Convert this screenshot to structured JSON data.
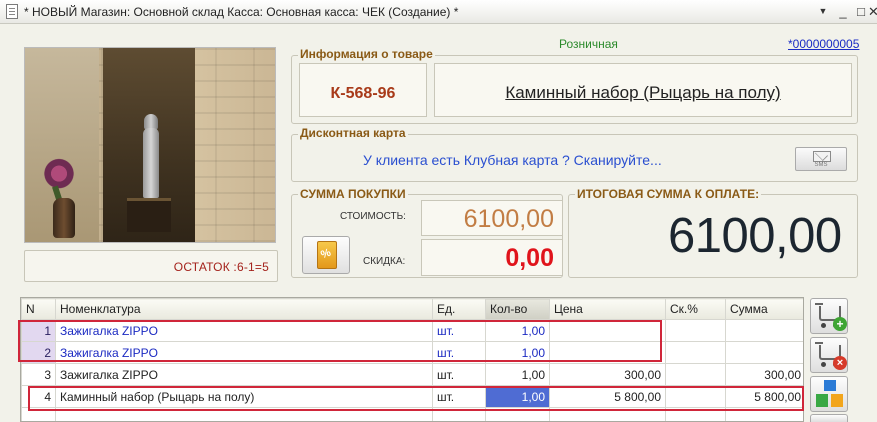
{
  "window": {
    "title": "* НОВЫЙ Магазин: Основной склад Касса: Основная касса: ЧЕК (Создание) *",
    "menu_glyph": "▼",
    "minimize_glyph": "_",
    "maximize_glyph": "□",
    "close_glyph": "✕"
  },
  "header": {
    "price_type": "Розничная",
    "doc_number": "*0000000005"
  },
  "stock": {
    "text": "ОСТАТОК :6-1=5"
  },
  "product_info": {
    "label": "Информация о товаре",
    "article": "К-568-96",
    "name": "Каминный набор (Рыцарь на полу)"
  },
  "discount_card": {
    "label": "Дисконтная карта",
    "prompt": "У клиента есть Клубная карта ? Сканируйте...",
    "sms_label": "SMS"
  },
  "purchase": {
    "label": "СУММА ПОКУПКИ",
    "cost_label": "СТОИМОСТЬ:",
    "cost_value": "6100,00",
    "discount_label": "СКИДКА:",
    "discount_value": "0,00",
    "coupon_glyph": "%"
  },
  "total": {
    "label": "ИТОГОВАЯ СУММА К ОПЛАТЕ:",
    "value": "6100,00"
  },
  "table": {
    "columns": [
      "N",
      "Номенклатура",
      "Ед.",
      "Кол-во",
      "Цена",
      "Ск.%",
      "Сумма"
    ],
    "rows": [
      {
        "n": "1",
        "item": "Зажигалка ZIPPO",
        "unit": "шт.",
        "qty": "1,00",
        "price": "",
        "disc": "",
        "sum": ""
      },
      {
        "n": "2",
        "item": "Зажигалка ZIPPO",
        "unit": "шт.",
        "qty": "1,00",
        "price": "",
        "disc": "",
        "sum": ""
      },
      {
        "n": "3",
        "item": "Зажигалка ZIPPO",
        "unit": "шт.",
        "qty": "1,00",
        "price": "300,00",
        "disc": "",
        "sum": "300,00"
      },
      {
        "n": "4",
        "item": "Каминный набор (Рыцарь на полу)",
        "unit": "шт.",
        "qty": "1,00",
        "price": "5 800,00",
        "disc": "",
        "sum": "5 800,00"
      }
    ]
  },
  "side_buttons": {
    "add_glyph": "+",
    "remove_glyph": "×"
  },
  "colors": {
    "accent_label": "#8a5a16",
    "highlight_border": "#d0263a",
    "link_blue": "#1a2bc4",
    "selection": "#4f6cd3"
  },
  "icons": [
    "document-icon",
    "menu-arrow-icon",
    "minimize-icon",
    "maximize-icon",
    "close-icon",
    "sms-envelope-icon",
    "discount-coupon-icon",
    "cart-add-icon",
    "cart-remove-icon",
    "blocks-icon"
  ]
}
